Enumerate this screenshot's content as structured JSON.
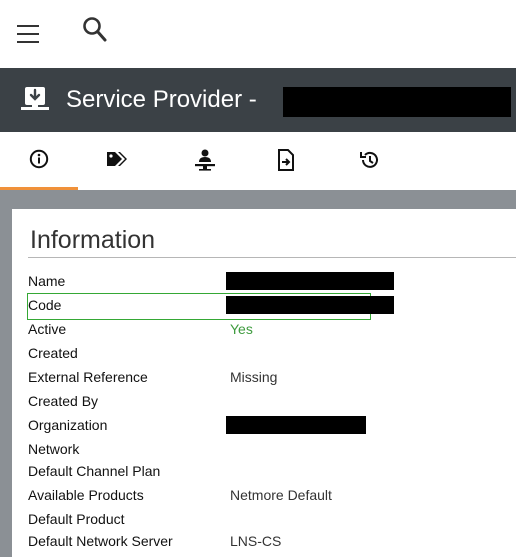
{
  "header": {
    "menu_icon": "hamburger-icon",
    "search_icon": "search-icon"
  },
  "titlebar": {
    "icon": "service-provider-icon",
    "title": "Service Provider -"
  },
  "tabs": [
    {
      "name": "information",
      "icon": "info-icon"
    },
    {
      "name": "tags",
      "icon": "tags-icon"
    },
    {
      "name": "users",
      "icon": "person-icon"
    },
    {
      "name": "documents",
      "icon": "document-icon"
    },
    {
      "name": "history",
      "icon": "history-icon"
    }
  ],
  "info": {
    "title": "Information",
    "rows": [
      {
        "label": "Name",
        "value": ""
      },
      {
        "label": "Code",
        "value": ""
      },
      {
        "label": "Active",
        "value": "Yes"
      },
      {
        "label": "Created",
        "value": ""
      },
      {
        "label": "External Reference",
        "value": "Missing"
      },
      {
        "label": "Created By",
        "value": ""
      },
      {
        "label": "Organization",
        "value": ""
      },
      {
        "label": "Network",
        "value": ""
      },
      {
        "label": "Default Channel Plan",
        "value": ""
      },
      {
        "label": "Available Products",
        "value": "Netmore Default"
      },
      {
        "label": "Default Product",
        "value": ""
      },
      {
        "label": "Default Network Server",
        "value": "LNS-CS"
      }
    ]
  },
  "colors": {
    "titlebar": "#3b4146",
    "active_tab_underline": "#f0913a",
    "active_value": "#3e9b3e",
    "focus_outline": "#35a835",
    "panel_frame": "#8b9095"
  }
}
